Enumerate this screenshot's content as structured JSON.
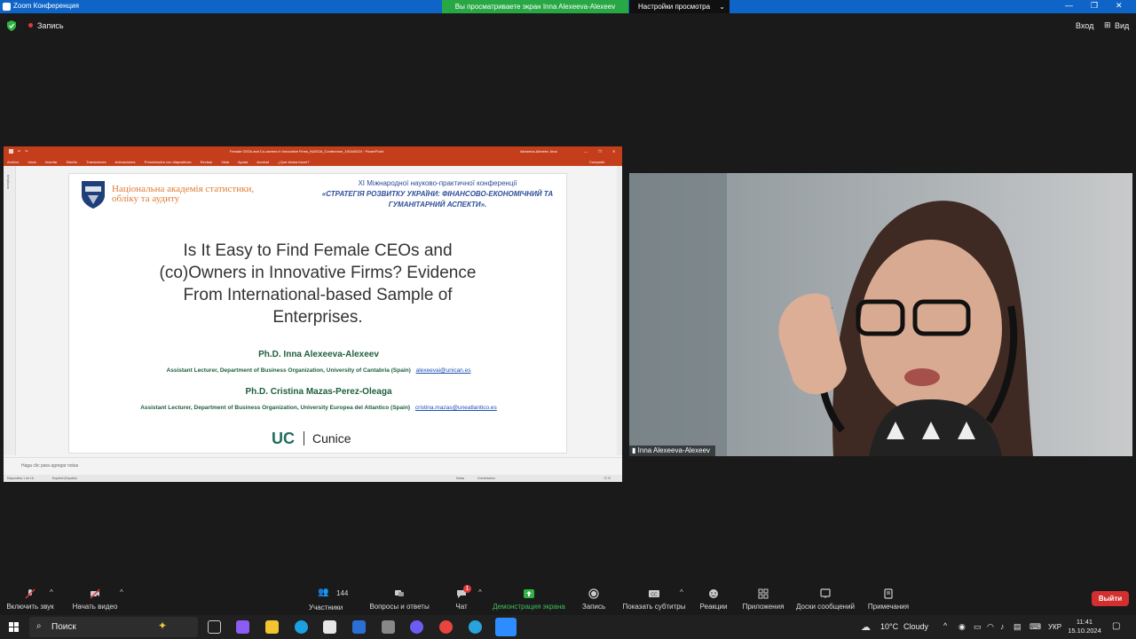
{
  "window": {
    "title": "Zoom Конференция",
    "share_banner": "Вы просматриваете экран Inna Alexeeva-Alexeev",
    "view_settings": "Настройки просмотра",
    "recording_label": "Запись",
    "exit_fullscreen": "Вход",
    "view_label": "Вид"
  },
  "powerpoint": {
    "window_title": "Female CEOs and Co-owners in Innovative Firms_NASOA_Conference_15Oct2024 · PowerPoint",
    "user": "Alexeeva-Alexeev, Inna",
    "ribbon": [
      "Archivo",
      "Inicio",
      "Insertar",
      "Diseño",
      "Transiciones",
      "Animaciones",
      "Presentación con diapositivas",
      "Revisar",
      "Vista",
      "Ayuda",
      "Acrobat",
      "¿Qué desea hacer?"
    ],
    "share_btn": "Compartir",
    "notes_placeholder": "Haga clic para agregar notas",
    "status_slide": "Diapositiva 1 de 16",
    "status_lang": "Español (España)",
    "status_notes": "Notas",
    "status_comments": "Comentarios",
    "zoom": "72 %",
    "side_panel_label": "Miniaturas"
  },
  "slide": {
    "org_name_line1": "Національна академія статистики,",
    "org_name_line2": "обліку та аудиту",
    "conf_line1": "ХІ Міжнародної науково-практичної конференції",
    "conf_line2": "«СТРАТЕГІЯ РОЗВИТКУ УКРАЇНИ: ФІНАНСОВО-ЕКОНОМІЧНИЙ ТА",
    "conf_line3": "ГУМАНІТАРНИЙ АСПЕКТИ».",
    "title_line1": "Is It Easy to Find Female CEOs and",
    "title_line2": "(co)Owners in Innovative Firms? Evidence",
    "title_line3": "From International-based Sample of",
    "title_line4": "Enterprises.",
    "author1_name": "Ph.D. Inna Alexeeva-Alexeev",
    "author1_affil": "Assistant Lecturer, Department of Business Organization, University of Cantabria (Spain)",
    "author1_email": "alexeevai@unican.es",
    "author2_name": "Ph.D. Cristina Mazas-Perez-Oleaga",
    "author2_affil": "Assistant Lecturer, Department of Business Organization, University Europea del Atlantico (Spain)",
    "author2_email": "cristina.mazas@uneatlantico.es",
    "logo_uc": "UC",
    "logo_cunice": "Cunice"
  },
  "video": {
    "participant_name": "Inna Alexeeva-Alexeev"
  },
  "toolbar": {
    "mute": "Включить звук",
    "video": "Начать видео",
    "participants": "Участники",
    "participants_count": "144",
    "qa": "Вопросы и ответы",
    "chat": "Чат",
    "chat_badge": "1",
    "share": "Демонстрация экрана",
    "record": "Запись",
    "captions": "Показать субтитры",
    "reactions": "Реакции",
    "apps": "Приложения",
    "whiteboards": "Доски сообщений",
    "notes": "Примечания",
    "leave": "Выйти"
  },
  "taskbar": {
    "search": "Поиск",
    "weather_temp": "10°C",
    "weather_desc": "Cloudy",
    "lang": "УКР",
    "time": "11:41",
    "date": "15.10.2024"
  },
  "colors": {
    "zoom_blue": "#0f64c8",
    "share_green": "#28a745",
    "ppt_orange": "#c43e1c",
    "leave_red": "#d32f2f"
  }
}
